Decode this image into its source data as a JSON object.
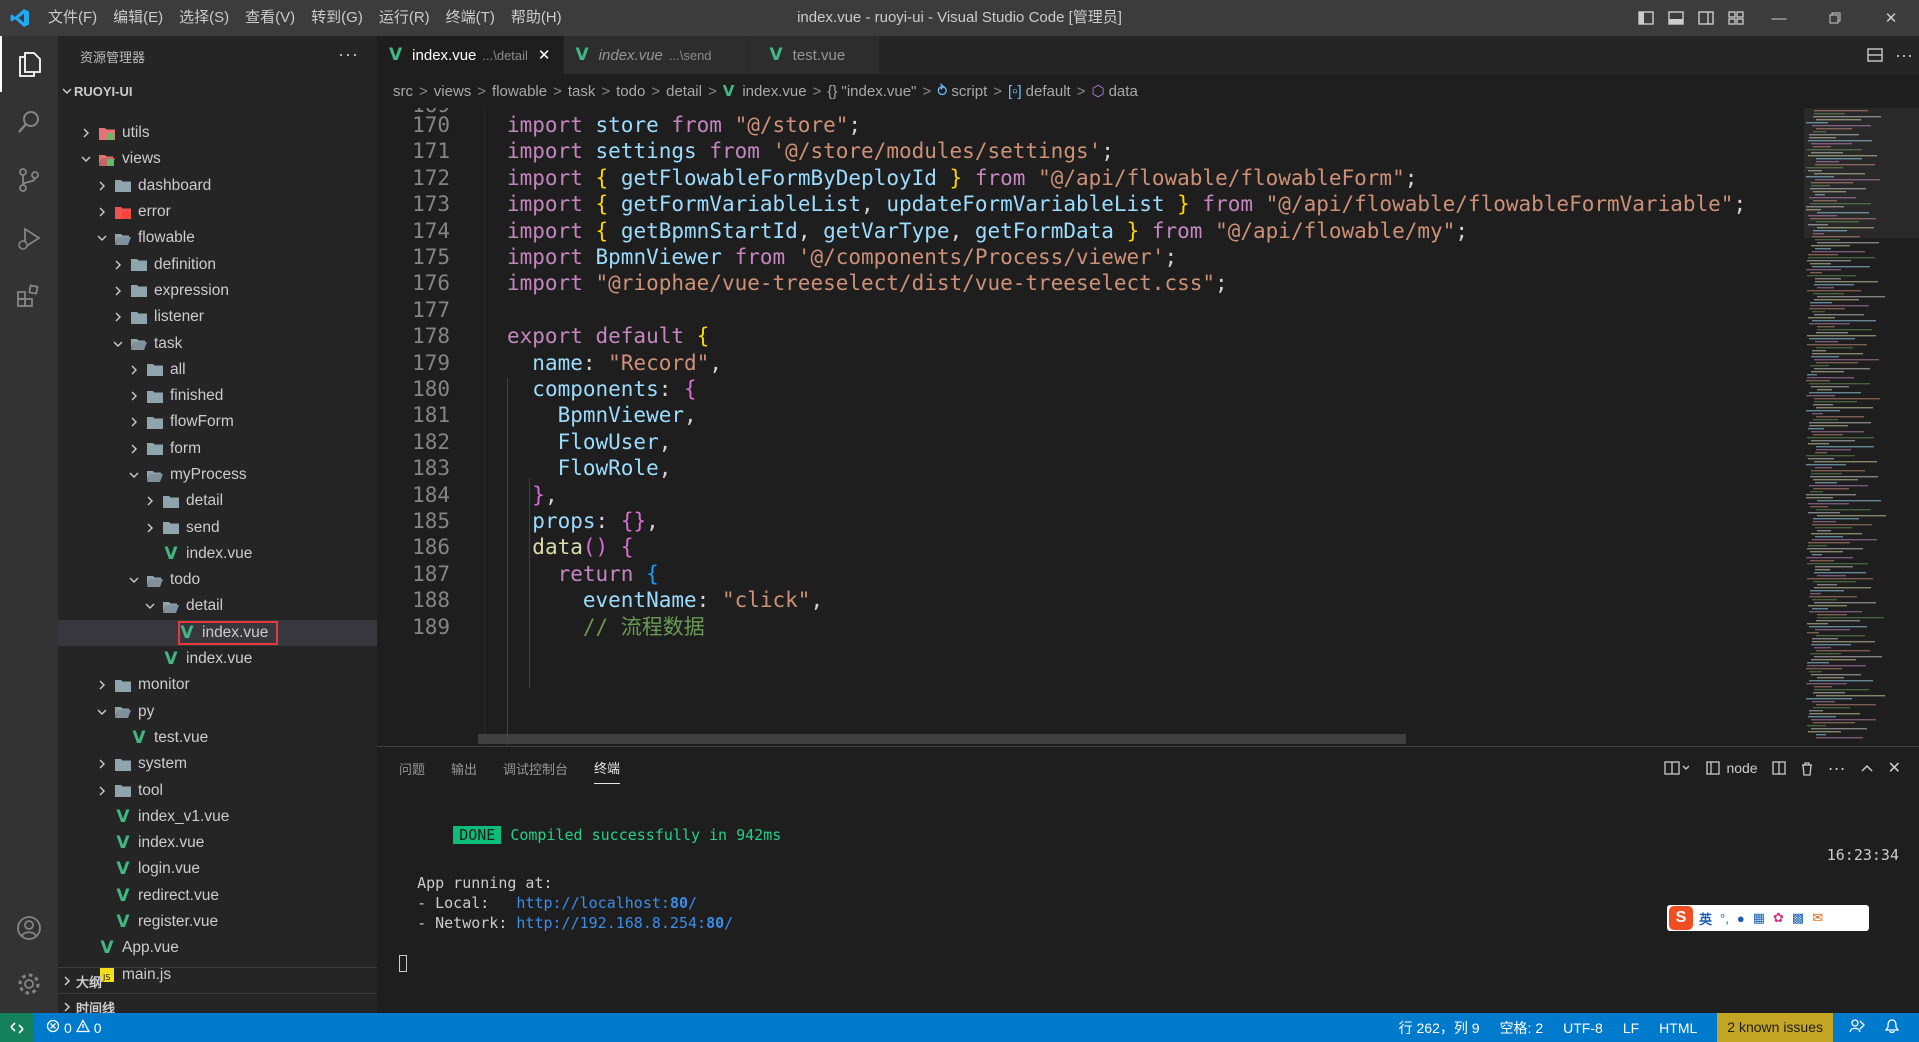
{
  "titlebar": {
    "menu": [
      "文件(F)",
      "编辑(E)",
      "选择(S)",
      "查看(V)",
      "转到(G)",
      "运行(R)",
      "终端(T)",
      "帮助(H)"
    ],
    "title": "index.vue - ruoyi-ui - Visual Studio Code [管理员]"
  },
  "sidebar": {
    "title": "资源管理器",
    "root": "RUOYI-UI",
    "outline": "大纲",
    "timeline": "时间线",
    "tree": [
      {
        "label": "utils",
        "depth": 1,
        "type": "folder-special"
      },
      {
        "label": "views",
        "depth": 1,
        "type": "folder-special",
        "open": true
      },
      {
        "label": "dashboard",
        "depth": 2,
        "type": "folder"
      },
      {
        "label": "error",
        "depth": 2,
        "type": "folder-error"
      },
      {
        "label": "flowable",
        "depth": 2,
        "type": "folder",
        "open": true
      },
      {
        "label": "definition",
        "depth": 3,
        "type": "folder"
      },
      {
        "label": "expression",
        "depth": 3,
        "type": "folder"
      },
      {
        "label": "listener",
        "depth": 3,
        "type": "folder"
      },
      {
        "label": "task",
        "depth": 3,
        "type": "folder",
        "open": true
      },
      {
        "label": "all",
        "depth": 4,
        "type": "folder"
      },
      {
        "label": "finished",
        "depth": 4,
        "type": "folder"
      },
      {
        "label": "flowForm",
        "depth": 4,
        "type": "folder"
      },
      {
        "label": "form",
        "depth": 4,
        "type": "folder"
      },
      {
        "label": "myProcess",
        "depth": 4,
        "type": "folder",
        "open": true
      },
      {
        "label": "detail",
        "depth": 5,
        "type": "folder"
      },
      {
        "label": "send",
        "depth": 5,
        "type": "folder"
      },
      {
        "label": "index.vue",
        "depth": 5,
        "type": "vue"
      },
      {
        "label": "todo",
        "depth": 4,
        "type": "folder",
        "open": true
      },
      {
        "label": "detail",
        "depth": 5,
        "type": "folder",
        "open": true
      },
      {
        "label": "index.vue",
        "depth": 6,
        "type": "vue",
        "selected": true
      },
      {
        "label": "index.vue",
        "depth": 5,
        "type": "vue"
      },
      {
        "label": "monitor",
        "depth": 2,
        "type": "folder"
      },
      {
        "label": "py",
        "depth": 2,
        "type": "folder",
        "open": true
      },
      {
        "label": "test.vue",
        "depth": 3,
        "type": "vue"
      },
      {
        "label": "system",
        "depth": 2,
        "type": "folder"
      },
      {
        "label": "tool",
        "depth": 2,
        "type": "folder"
      },
      {
        "label": "index_v1.vue",
        "depth": 2,
        "type": "vue"
      },
      {
        "label": "index.vue",
        "depth": 2,
        "type": "vue"
      },
      {
        "label": "login.vue",
        "depth": 2,
        "type": "vue"
      },
      {
        "label": "redirect.vue",
        "depth": 2,
        "type": "vue"
      },
      {
        "label": "register.vue",
        "depth": 2,
        "type": "vue"
      },
      {
        "label": "App.vue",
        "depth": 1,
        "type": "vue"
      },
      {
        "label": "main.js",
        "depth": 1,
        "type": "js"
      }
    ]
  },
  "tabs": [
    {
      "name": "index.vue",
      "desc": "...\\detail",
      "active": true,
      "preview": false
    },
    {
      "name": "index.vue",
      "desc": "...\\send",
      "active": false,
      "preview": true
    },
    {
      "name": "test.vue",
      "desc": "",
      "active": false,
      "preview": false
    }
  ],
  "breadcrumb": [
    "src",
    "views",
    "flowable",
    "task",
    "todo",
    "detail",
    "index.vue",
    "{} \"index.vue\"",
    "script",
    "default",
    "data"
  ],
  "code": {
    "lines": [
      {
        "n": "170",
        "t": [
          [
            "kw",
            "import "
          ],
          [
            "id",
            "store "
          ],
          [
            "kw",
            "from "
          ],
          [
            "str",
            "\"@/store\""
          ],
          [
            "pl",
            ";"
          ]
        ]
      },
      {
        "n": "171",
        "t": [
          [
            "kw",
            "import "
          ],
          [
            "id",
            "settings "
          ],
          [
            "kw",
            "from "
          ],
          [
            "str",
            "'@/store/modules/settings'"
          ],
          [
            "pl",
            ";"
          ]
        ]
      },
      {
        "n": "172",
        "t": [
          [
            "kw",
            "import "
          ],
          [
            "br1",
            "{ "
          ],
          [
            "id",
            "getFlowableFormByDeployId "
          ],
          [
            "br1",
            "} "
          ],
          [
            "kw",
            "from "
          ],
          [
            "str",
            "\"@/api/flowable/flowableForm\""
          ],
          [
            "pl",
            ";"
          ]
        ]
      },
      {
        "n": "173",
        "t": [
          [
            "kw",
            "import "
          ],
          [
            "br1",
            "{ "
          ],
          [
            "id",
            "getFormVariableList"
          ],
          [
            "pl",
            ", "
          ],
          [
            "id",
            "updateFormVariableList "
          ],
          [
            "br1",
            "} "
          ],
          [
            "kw",
            "from "
          ],
          [
            "str",
            "\"@/api/flowable/flowableFormVariable\""
          ],
          [
            "pl",
            ";"
          ]
        ]
      },
      {
        "n": "174",
        "t": [
          [
            "kw",
            "import "
          ],
          [
            "br1",
            "{ "
          ],
          [
            "id",
            "getBpmnStartId"
          ],
          [
            "pl",
            ", "
          ],
          [
            "id",
            "getVarType"
          ],
          [
            "pl",
            ", "
          ],
          [
            "id",
            "getFormData "
          ],
          [
            "br1",
            "} "
          ],
          [
            "kw",
            "from "
          ],
          [
            "str",
            "\"@/api/flowable/my\""
          ],
          [
            "pl",
            ";"
          ]
        ]
      },
      {
        "n": "175",
        "t": [
          [
            "kw",
            "import "
          ],
          [
            "id",
            "BpmnViewer "
          ],
          [
            "kw",
            "from "
          ],
          [
            "str",
            "'@/components/Process/viewer'"
          ],
          [
            "pl",
            ";"
          ]
        ]
      },
      {
        "n": "176",
        "t": [
          [
            "kw",
            "import "
          ],
          [
            "str",
            "\"@riophae/vue-treeselect/dist/vue-treeselect.css\""
          ],
          [
            "pl",
            ";"
          ]
        ]
      },
      {
        "n": "177",
        "t": []
      },
      {
        "n": "178",
        "t": [
          [
            "kw",
            "export default "
          ],
          [
            "br1",
            "{"
          ]
        ]
      },
      {
        "n": "179",
        "t": [
          [
            "pl",
            "  "
          ],
          [
            "id",
            "name"
          ],
          [
            "pl",
            ": "
          ],
          [
            "str",
            "\"Record\""
          ],
          [
            "pl",
            ","
          ]
        ]
      },
      {
        "n": "180",
        "t": [
          [
            "pl",
            "  "
          ],
          [
            "id",
            "components"
          ],
          [
            "pl",
            ": "
          ],
          [
            "br2",
            "{"
          ]
        ]
      },
      {
        "n": "181",
        "t": [
          [
            "pl",
            "    "
          ],
          [
            "id",
            "BpmnViewer"
          ],
          [
            "pl",
            ","
          ]
        ]
      },
      {
        "n": "182",
        "t": [
          [
            "pl",
            "    "
          ],
          [
            "id",
            "FlowUser"
          ],
          [
            "pl",
            ","
          ]
        ]
      },
      {
        "n": "183",
        "t": [
          [
            "pl",
            "    "
          ],
          [
            "id",
            "FlowRole"
          ],
          [
            "pl",
            ","
          ]
        ]
      },
      {
        "n": "184",
        "t": [
          [
            "pl",
            "  "
          ],
          [
            "br2",
            "}"
          ],
          [
            "pl",
            ","
          ]
        ]
      },
      {
        "n": "185",
        "t": [
          [
            "pl",
            "  "
          ],
          [
            "id",
            "props"
          ],
          [
            "pl",
            ": "
          ],
          [
            "br2",
            "{}"
          ],
          [
            "pl",
            ","
          ]
        ]
      },
      {
        "n": "186",
        "t": [
          [
            "pl",
            "  "
          ],
          [
            "fn",
            "data"
          ],
          [
            "br2",
            "() "
          ],
          [
            "br2",
            "{"
          ]
        ]
      },
      {
        "n": "187",
        "t": [
          [
            "pl",
            "    "
          ],
          [
            "kw",
            "return "
          ],
          [
            "br3",
            "{"
          ]
        ]
      },
      {
        "n": "188",
        "t": [
          [
            "pl",
            "      "
          ],
          [
            "id",
            "eventName"
          ],
          [
            "pl",
            ": "
          ],
          [
            "str",
            "\"click\""
          ],
          [
            "pl",
            ","
          ]
        ]
      },
      {
        "n": "189",
        "t": [
          [
            "pl",
            "      "
          ],
          [
            "cm",
            "// 流程数据"
          ]
        ]
      }
    ]
  },
  "panel": {
    "tabs": [
      "问题",
      "输出",
      "调试控制台",
      "终端"
    ],
    "active_tab": "终端",
    "shell": "node",
    "terminal": {
      "done": "DONE",
      "compiled": "Compiled successfully in 942ms",
      "time": "16:23:34",
      "running": "App running at:",
      "local_label": "- Local:   ",
      "local_url": "http://localhost:",
      "local_port": "80",
      "network_label": "- Network: ",
      "network_url": "http://192.168.8.254:",
      "network_port": "80"
    },
    "ime_label": "英"
  },
  "statusbar": {
    "errors": "0",
    "warnings": "0",
    "position": "行 262，列 9",
    "spaces": "空格: 2",
    "encoding": "UTF-8",
    "eol": "LF",
    "language": "HTML",
    "issues": "2 known issues"
  },
  "colors": {
    "vue": "#41b883",
    "statusbar": "#007acc",
    "highlight_box": "#e5393b",
    "done_badge": "#0dbc79"
  }
}
